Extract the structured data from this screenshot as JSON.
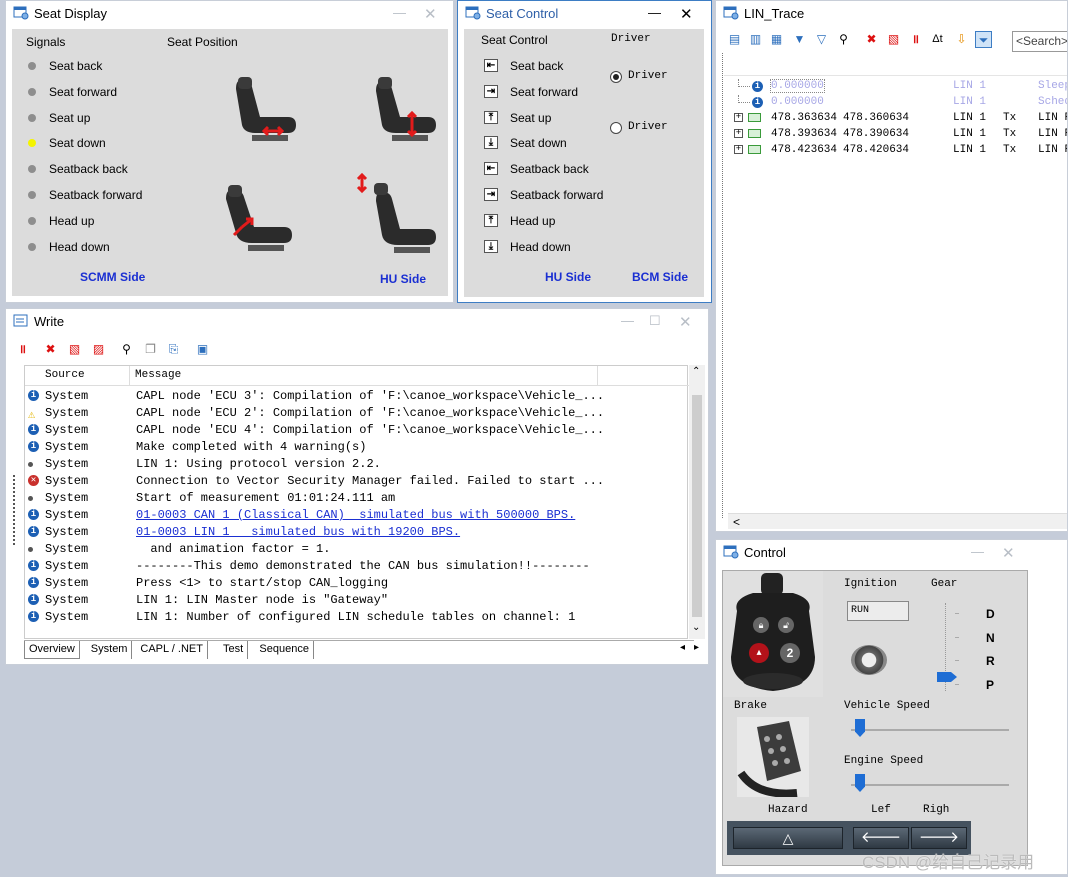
{
  "seat_display": {
    "title": "Seat Display",
    "signals_header": "Signals",
    "position_header": "Seat Position",
    "signals": [
      {
        "label": "Seat back",
        "active": false
      },
      {
        "label": "Seat forward",
        "active": false
      },
      {
        "label": "Seat up",
        "active": false
      },
      {
        "label": "Seat down",
        "active": true
      },
      {
        "label": "Seatback back",
        "active": false
      },
      {
        "label": "Seatback forward",
        "active": false
      },
      {
        "label": "Head up",
        "active": false
      },
      {
        "label": "Head down",
        "active": false
      }
    ],
    "footer_left": "SCMM Side",
    "footer_right": "HU Side"
  },
  "seat_control": {
    "title": "Seat Control",
    "col_header": "Seat Control",
    "driver_header": "Driver",
    "buttons": [
      {
        "label": "Seat back",
        "icon": "arrow-left-icon"
      },
      {
        "label": "Seat forward",
        "icon": "arrow-right-icon"
      },
      {
        "label": "Seat up",
        "icon": "arrow-up-icon"
      },
      {
        "label": "Seat down",
        "icon": "arrow-down-icon"
      },
      {
        "label": "Seatback back",
        "icon": "arrow-left-icon"
      },
      {
        "label": "Seatback forward",
        "icon": "arrow-right-icon"
      },
      {
        "label": "Head up",
        "icon": "arrow-up-icon"
      },
      {
        "label": "Head down",
        "icon": "arrow-down-icon"
      }
    ],
    "radios": [
      {
        "label": "Driver",
        "selected": true
      },
      {
        "label": "Driver",
        "selected": false
      }
    ],
    "footer_left": "HU Side",
    "footer_right": "BCM Side"
  },
  "lin_trace": {
    "title": "LIN_Trace",
    "search_placeholder": "<Search>",
    "rows": [
      {
        "t1": "0.000000",
        "t2": "",
        "ch": "LIN 1",
        "dir": "",
        "name": "Sleep",
        "kind": "info"
      },
      {
        "t1": "0.000000",
        "t2": "",
        "ch": "LIN 1",
        "dir": "",
        "name": "Sched",
        "kind": "info"
      },
      {
        "t1": "478.363634",
        "t2": "478.360634",
        "ch": "LIN 1",
        "dir": "Tx",
        "name": "LIN F",
        "kind": "msg"
      },
      {
        "t1": "478.393634",
        "t2": "478.390634",
        "ch": "LIN 1",
        "dir": "Tx",
        "name": "LIN F",
        "kind": "msg"
      },
      {
        "t1": "478.423634",
        "t2": "478.420634",
        "ch": "LIN 1",
        "dir": "Tx",
        "name": "LIN F",
        "kind": "msg"
      }
    ],
    "scroll_left": "<"
  },
  "write": {
    "title": "Write",
    "col_source": "Source",
    "col_message": "Message",
    "rows": [
      {
        "type": "info",
        "source": "System",
        "message": "CAPL node 'ECU 3': Compilation of 'F:\\canoe_workspace\\Vehicle_...",
        "link": false
      },
      {
        "type": "warning",
        "source": "System",
        "message": "CAPL node 'ECU 2': Compilation of 'F:\\canoe_workspace\\Vehicle_...",
        "link": false
      },
      {
        "type": "info",
        "source": "System",
        "message": "CAPL node 'ECU 4': Compilation of 'F:\\canoe_workspace\\Vehicle_...",
        "link": false
      },
      {
        "type": "info",
        "source": "System",
        "message": "Make completed with 4 warning(s)",
        "link": false
      },
      {
        "type": "dot",
        "source": "System",
        "message": "LIN 1: Using protocol version 2.2.",
        "link": false
      },
      {
        "type": "error",
        "source": "System",
        "message": "Connection to Vector Security Manager failed. Failed to start ...",
        "link": false
      },
      {
        "type": "dot",
        "source": "System",
        "message": "Start of measurement 01:01:24.111 am",
        "link": false
      },
      {
        "type": "info",
        "source": "System",
        "message": "01-0003 CAN 1 (Classical CAN)  simulated bus with 500000 BPS.",
        "link": true
      },
      {
        "type": "info",
        "source": "System",
        "message": "01-0003 LIN 1   simulated bus with 19200 BPS.",
        "link": true
      },
      {
        "type": "dot",
        "source": "System",
        "message": "  and animation factor = 1.",
        "link": false
      },
      {
        "type": "info",
        "source": "System",
        "message": "--------This demo demonstrated the CAN bus simulation!!--------",
        "link": false
      },
      {
        "type": "info",
        "source": "System",
        "message": "Press <1> to start/stop CAN_logging",
        "link": false
      },
      {
        "type": "info",
        "source": "System",
        "message": "LIN 1: LIN Master node is \"Gateway\"",
        "link": false
      },
      {
        "type": "info",
        "source": "System",
        "message": "LIN 1: Number of configured LIN schedule tables on channel: 1",
        "link": false
      }
    ],
    "tabs": [
      "Overview",
      "System",
      "CAPL / .NET",
      "Test",
      "Sequence"
    ],
    "active_tab": "Overview"
  },
  "control": {
    "title": "Control",
    "ignition_label": "Ignition",
    "ignition_value": "RUN",
    "gear_label": "Gear",
    "gears": [
      "D",
      "N",
      "R",
      "P"
    ],
    "selected_gear": "P",
    "brake_label": "Brake",
    "vehicle_speed_label": "Vehicle Speed",
    "vehicle_speed_level": 0,
    "engine_speed_label": "Engine Speed",
    "engine_speed_level": 0,
    "hazard_label": "Hazard",
    "left_label": "Lef",
    "right_label": "Righ",
    "fob_buttons": [
      "lock",
      "unlock",
      "1",
      "2"
    ]
  },
  "watermark": "CSDN @给自己记录用"
}
